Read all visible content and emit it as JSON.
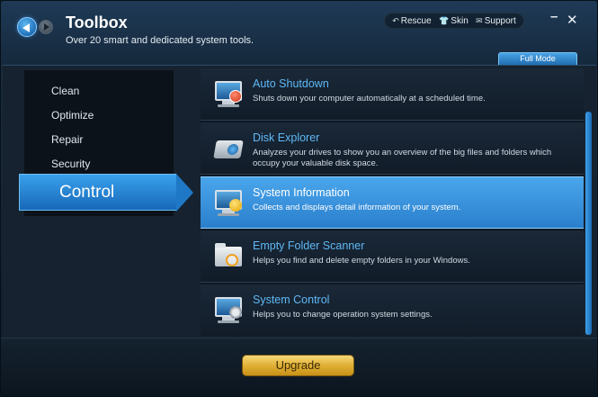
{
  "header": {
    "title": "Toolbox",
    "subtitle": "Over 20 smart and dedicated system tools.",
    "links": [
      {
        "label": "Rescue",
        "icon": "back-arrow-icon"
      },
      {
        "label": "Skin",
        "icon": "shirt-icon"
      },
      {
        "label": "Support",
        "icon": "mail-icon"
      }
    ],
    "full_mode": "Full Mode"
  },
  "sidebar": {
    "items": [
      {
        "label": "Clean"
      },
      {
        "label": "Optimize"
      },
      {
        "label": "Repair"
      },
      {
        "label": "Security"
      }
    ],
    "active": "Control"
  },
  "tools": [
    {
      "title": "Auto Shutdown",
      "desc": "Shuts down your computer automatically at a scheduled time."
    },
    {
      "title": "Disk Explorer",
      "desc": "Analyzes your drives to show you an overview of the big files and folders which occupy your valuable disk space."
    },
    {
      "title": "System Information",
      "desc": "Collects and displays detail information of your system."
    },
    {
      "title": "Empty Folder Scanner",
      "desc": "Helps you find and delete empty folders in your Windows."
    },
    {
      "title": "System Control",
      "desc": "Helps you to change operation system settings."
    }
  ],
  "footer": {
    "upgrade": "Upgrade"
  },
  "colors": {
    "accent": "#2a7fcc",
    "title_blue": "#5fb8f5",
    "upgrade_gold": "#e0b035"
  }
}
